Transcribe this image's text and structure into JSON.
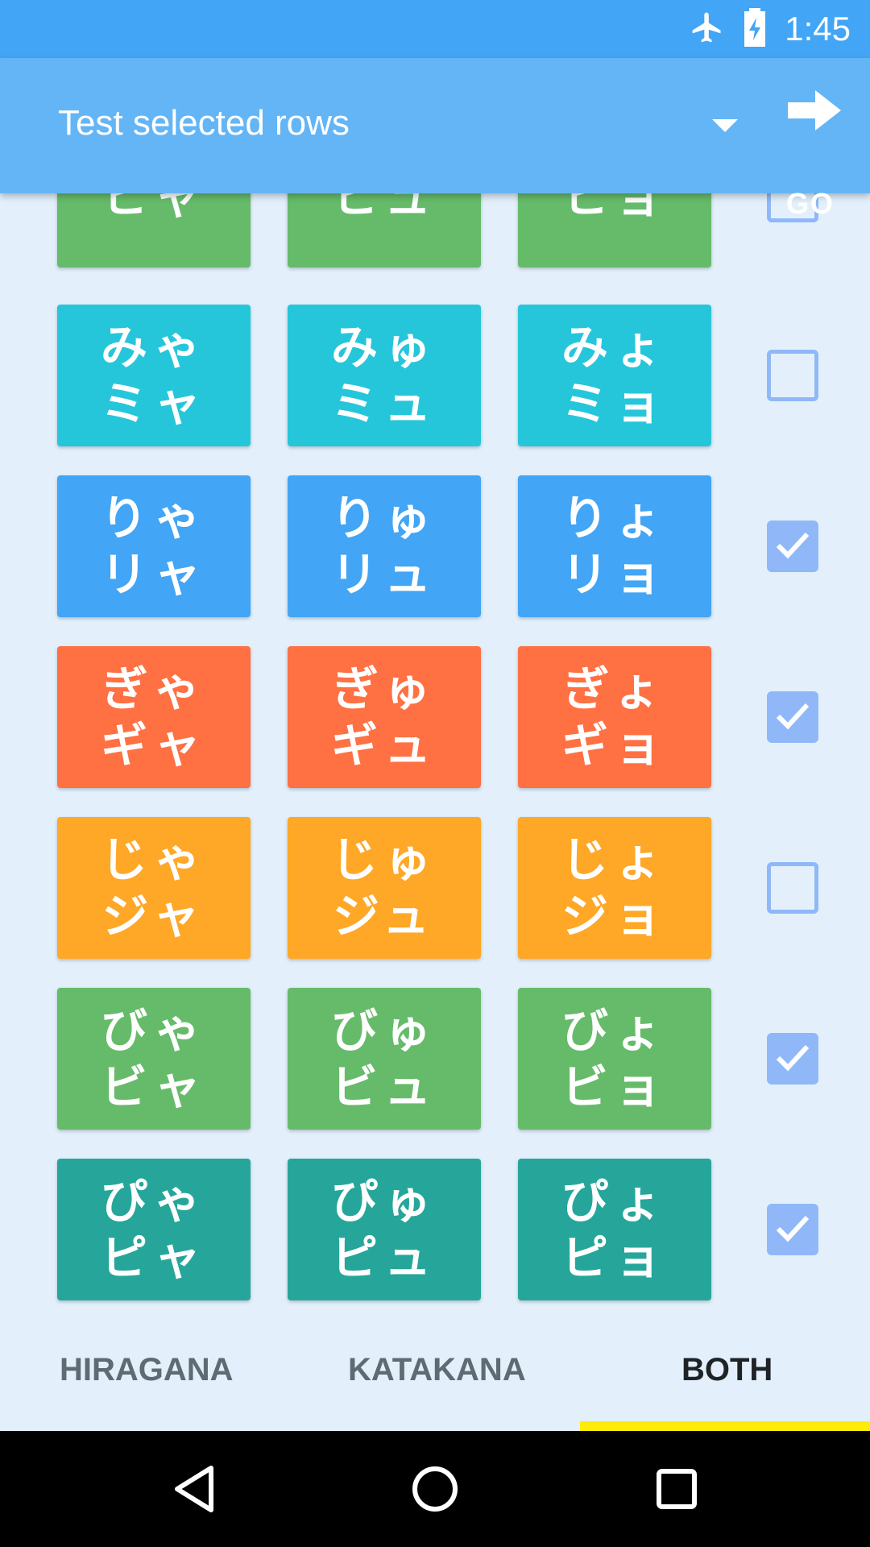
{
  "status_bar": {
    "time": "1:45",
    "icons": [
      "airplane-mode-icon",
      "battery-charging-icon"
    ]
  },
  "toolbar": {
    "title": "Test selected rows",
    "go_label": "GO",
    "icons": [
      "dropdown-arrow-icon",
      "go-arrow-icon"
    ]
  },
  "rows": [
    {
      "tiles": [
        [
          "",
          "ヒャ"
        ],
        [
          "",
          "ヒュ"
        ],
        [
          "",
          "ヒョ"
        ]
      ],
      "color": "#66bb6a",
      "checked": false
    },
    {
      "tiles": [
        [
          "みゃ",
          "ミャ"
        ],
        [
          "みゅ",
          "ミュ"
        ],
        [
          "みょ",
          "ミョ"
        ]
      ],
      "color": "#26c6da",
      "checked": false
    },
    {
      "tiles": [
        [
          "りゃ",
          "リャ"
        ],
        [
          "りゅ",
          "リュ"
        ],
        [
          "りょ",
          "リョ"
        ]
      ],
      "color": "#42a5f5",
      "checked": true
    },
    {
      "tiles": [
        [
          "ぎゃ",
          "ギャ"
        ],
        [
          "ぎゅ",
          "ギュ"
        ],
        [
          "ぎょ",
          "ギョ"
        ]
      ],
      "color": "#ff7043",
      "checked": true
    },
    {
      "tiles": [
        [
          "じゃ",
          "ジャ"
        ],
        [
          "じゅ",
          "ジュ"
        ],
        [
          "じょ",
          "ジョ"
        ]
      ],
      "color": "#ffa726",
      "checked": false
    },
    {
      "tiles": [
        [
          "びゃ",
          "ビャ"
        ],
        [
          "びゅ",
          "ビュ"
        ],
        [
          "びょ",
          "ビョ"
        ]
      ],
      "color": "#66bb6a",
      "checked": true
    },
    {
      "tiles": [
        [
          "ぴゃ",
          "ピャ"
        ],
        [
          "ぴゅ",
          "ピュ"
        ],
        [
          "ぴょ",
          "ピョ"
        ]
      ],
      "color": "#26a69a",
      "checked": true
    }
  ],
  "tabs": [
    {
      "label": "HIRAGANA",
      "active": false
    },
    {
      "label": "KATAKANA",
      "active": false
    },
    {
      "label": "BOTH",
      "active": true
    }
  ],
  "colors": {
    "status_bar": "#42a5f5",
    "toolbar": "#64b5f6",
    "background": "#e3f0fc",
    "checkbox": "#90b8f8",
    "tab_indicator": "#ffeb0a"
  },
  "nav_bar": {
    "icons": [
      "back-icon",
      "home-icon",
      "recents-icon"
    ]
  }
}
